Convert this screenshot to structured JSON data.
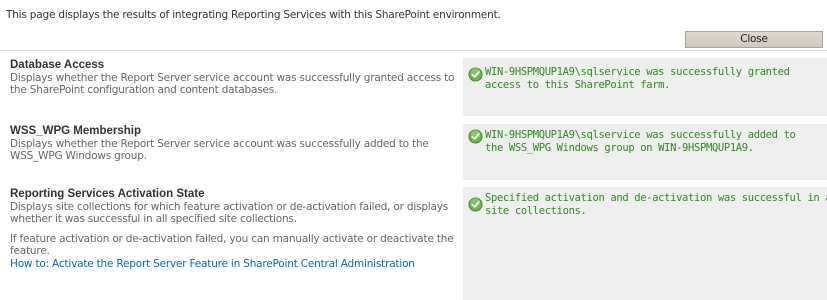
{
  "intro_text": "This page displays the results of integrating Reporting Services with this SharePoint environment.",
  "close_label": "Close",
  "status_color": "#2e8b1f",
  "sections": [
    {
      "title": "Database Access",
      "description": "Displays whether the Report Server service account was successfully granted access to the SharePoint configuration and content databases.",
      "result_icon": "success-check-icon",
      "result_line1": "WIN-9HSPMQUP1A9\\sqlservice was successfully granted",
      "result_line2": "access to this SharePoint farm."
    },
    {
      "title": "WSS_WPG Membership",
      "description": "Displays whether the Report Server service account was successfully added to the WSS_WPG Windows group.",
      "result_icon": "success-check-icon",
      "result_line1": "WIN-9HSPMQUP1A9\\sqlservice was successfully added to",
      "result_line2": "the WSS_WPG Windows group on WIN-9HSPMQUP1A9."
    },
    {
      "title": "Reporting Services Activation State",
      "description": "Displays site collections for which feature activation or de-activation failed, or displays whether it was successful in all specified site collections.",
      "description2": "If feature activation or de-activation failed, you can manually activate or deactivate the feature.",
      "link_text": "How to: Activate the Report Server Feature in SharePoint Central Administration",
      "result_icon": "success-check-icon",
      "result_line1": "Specified activation and de-activation was successful in all",
      "result_line2": "site collections."
    }
  ]
}
